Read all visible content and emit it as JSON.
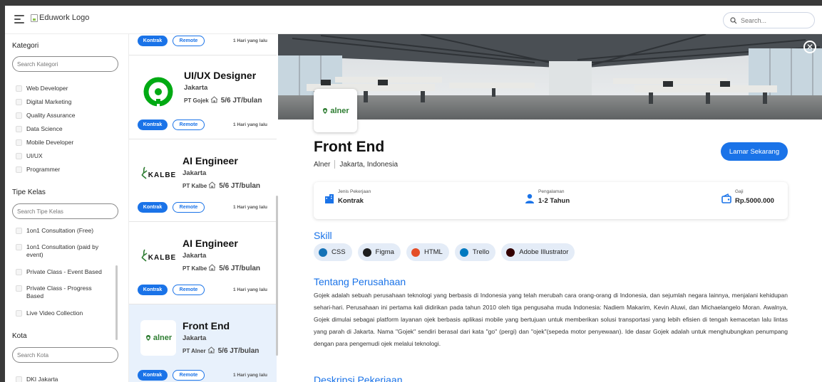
{
  "app": {
    "logo_alt": "Eduwork Logo",
    "search_placeholder": "Search..."
  },
  "sidebar": {
    "kategori": {
      "title": "Kategori",
      "search_placeholder": "Search Kategori",
      "items": [
        "Web Developer",
        "Digital Marketing",
        "Quality Assurance",
        "Data Science",
        "Mobile Developer",
        "UI/UX",
        "Programmer"
      ]
    },
    "tipe_kelas": {
      "title": "Tipe Kelas",
      "search_placeholder": "Search Tipe Kelas",
      "items": [
        "1on1 Consultation (Free)",
        "1on1 Consultation (paid by event)",
        "Private Class - Event Based",
        "Private Class - Progress Based",
        "Live Video Collection"
      ]
    },
    "kota": {
      "title": "Kota",
      "search_placeholder": "Search Kota",
      "items": [
        "DKI Jakarta"
      ]
    }
  },
  "jobs": [
    {
      "title": "",
      "city": "",
      "company": "",
      "salary": "",
      "tags": [
        "Kontrak",
        "Remote"
      ],
      "time": "1 Hari yang lalu"
    },
    {
      "title": "UI/UX Designer",
      "city": "Jakarta",
      "company": "PT Gojek",
      "salary": "5/6 JT/bulan",
      "tags": [
        "Kontrak",
        "Remote"
      ],
      "time": "1 Hari yang lalu",
      "logo": "gojek"
    },
    {
      "title": "AI Engineer",
      "city": "Jakarta",
      "company": "PT Kalbe",
      "salary": "5/6 JT/bulan",
      "tags": [
        "Kontrak",
        "Remote"
      ],
      "time": "1 Hari yang lalu",
      "logo": "kalbe",
      "logo_text": "KALBE"
    },
    {
      "title": "AI Engineer",
      "city": "Jakarta",
      "company": "PT Kalbe",
      "salary": "5/6 JT/bulan",
      "tags": [
        "Kontrak",
        "Remote"
      ],
      "time": "1 Hari yang lalu",
      "logo": "kalbe",
      "logo_text": "KALBE"
    },
    {
      "title": "Front End",
      "city": "Jakarta",
      "company": "PT Alner",
      "salary": "5/6 JT/bulan",
      "tags": [
        "Kontrak",
        "Remote"
      ],
      "time": "1 Hari yang lalu",
      "logo": "alner",
      "logo_text": "alner",
      "active": true
    }
  ],
  "detail": {
    "logo_text": "alner",
    "title": "Front End",
    "company": "Alner",
    "location": "Jakarta, Indonesia",
    "apply_label": "Lamar Sekarang",
    "info": {
      "jenis_label": "Jenis Pekerjaan",
      "jenis_value": "Kontrak",
      "pengalaman_label": "Pengalaman",
      "pengalaman_value": "1-2 Tahun",
      "gaji_label": "Gaji",
      "gaji_value": "Rp.5000.000"
    },
    "skill_heading": "Skill",
    "skills": [
      {
        "name": "CSS",
        "icon": "css-icon",
        "color": "#1572b6"
      },
      {
        "name": "Figma",
        "icon": "figma-icon",
        "color": "#1e1e1e"
      },
      {
        "name": "HTML",
        "icon": "html-icon",
        "color": "#e44d26"
      },
      {
        "name": "Trello",
        "icon": "trello-icon",
        "color": "#0079bf"
      },
      {
        "name": "Adobe Illustrator",
        "icon": "illustrator-icon",
        "color": "#330000"
      }
    ],
    "about_heading": "Tentang Perusahaan",
    "about_text": "Gojek adalah sebuah perusahaan teknologi yang berbasis di Indonesia yang telah merubah cara orang-orang di Indonesia, dan sejumlah negara lainnya, menjalani kehidupan sehari-hari. Perusahaan ini pertama kali didirikan pada tahun 2010 oleh tiga pengusaha muda Indonesia: Nadiem Makarim, Kevin Aluwi, dan Michaelangelo Moran. Awalnya, Gojek dimulai sebagai platform layanan ojek berbasis aplikasi mobile yang bertujuan untuk memberikan solusi transportasi yang lebih efisien di tengah kemacetan lalu lintas yang parah di Jakarta. Nama \"Gojek\" sendiri berasal dari kata \"go\" (pergi) dan \"ojek\"(sepeda motor penyewaan). Ide dasar Gojek adalah untuk menghubungkan penumpang dengan para pengemudi ojek melalui teknologi.",
    "desc_heading": "Deskripsi Pekerjaan"
  },
  "colors": {
    "accent": "#1a73e8",
    "active_card": "#e8f1fc",
    "gojek_green": "#00aa13",
    "alner_green": "#2e7d32",
    "kalbe_green": "#2e7d32"
  }
}
